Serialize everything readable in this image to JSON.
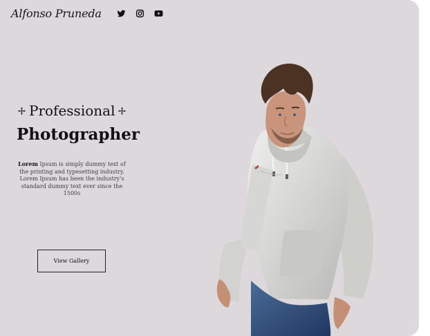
{
  "brand": {
    "logo_text": "Alfonso Pruneda"
  },
  "social": [
    {
      "icon": "twitter-icon"
    },
    {
      "icon": "instagram-icon"
    },
    {
      "icon": "youtube-icon"
    }
  ],
  "hero": {
    "title_line_1": "Professional",
    "title_line_2": "Photographer",
    "intro_strong": "Lorem",
    "intro_rest": " Ipsum is simply dummy text of the printing and typesetting industry. Lorem Ipsum has been the industry's standard dummy text ever since the 1500s",
    "cta_label": "View Gallery"
  },
  "colors": {
    "background": "#dcd8dc",
    "text": "#111111",
    "hoodie": "#d8d8d6",
    "jeans": "#2f4d79"
  }
}
